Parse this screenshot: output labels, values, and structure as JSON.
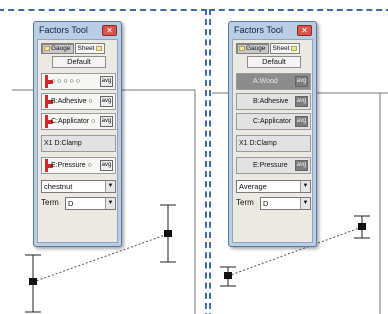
{
  "left_tool": {
    "title": "Factors Tool",
    "close_glyph": "✕",
    "toggle_gauge": "Gauge",
    "toggle_sheet": "Sheet",
    "default_label": "Default",
    "factors": [
      {
        "label": "○ ○ ○ ○ ○",
        "avg": "avg"
      },
      {
        "label": "B:Adhesive ○",
        "avg": "avg"
      },
      {
        "label": "C:Applicator ○",
        "avg": "avg"
      },
      {
        "label": "D:Clamp",
        "prefix": "X1"
      },
      {
        "label": "E:Pressure ○",
        "avg": "avg"
      }
    ],
    "level_value": "chestnut",
    "term_label": "Term",
    "term_value": "D"
  },
  "right_tool": {
    "title": "Factors Tool",
    "close_glyph": "✕",
    "toggle_gauge": "Gauge",
    "toggle_sheet": "Sheet",
    "default_label": "Default",
    "factors": [
      {
        "label": "A:Wood",
        "avg": "avg"
      },
      {
        "label": "B:Adhesive",
        "avg": "avg"
      },
      {
        "label": "C:Applicator",
        "avg": "avg"
      },
      {
        "label": "D:Clamp",
        "prefix": "X1"
      },
      {
        "label": "E:Pressure",
        "avg": "avg"
      }
    ],
    "level_value": "Average",
    "term_label": "Term",
    "term_value": "D"
  },
  "colors": {
    "frame": "#3e6aa8",
    "slider": "#d3292b",
    "window": "#b9cde4"
  }
}
